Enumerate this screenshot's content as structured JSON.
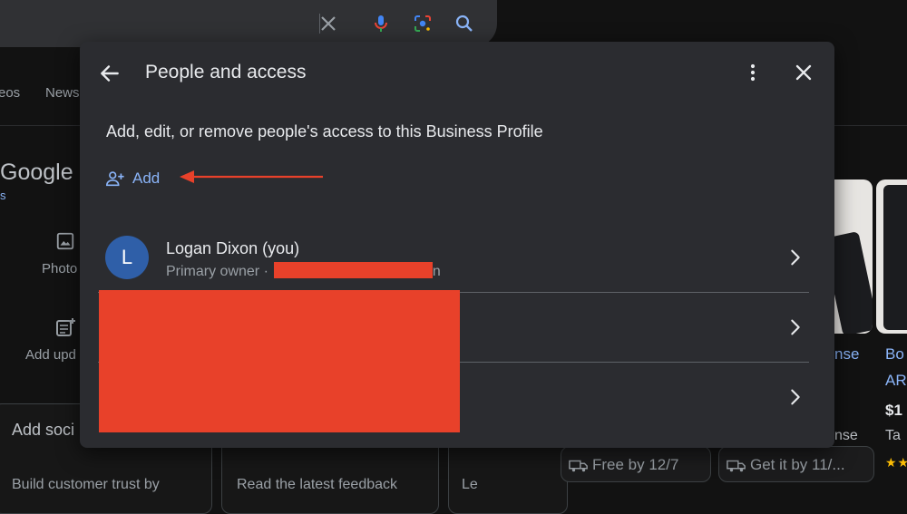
{
  "background": {
    "tabs": [
      "eos",
      "News"
    ],
    "brand_title": "Google",
    "brand_sub": "s",
    "actions": [
      "Photo",
      "Add upd"
    ],
    "cards": [
      {
        "title": "Add soci",
        "body": "Build customer trust by"
      },
      {
        "title": "",
        "body": "Read the latest feedback"
      },
      {
        "title": "",
        "body": "Le"
      }
    ],
    "products": {
      "link1": "nse",
      "link2a": "Bo",
      "link2b": "AR",
      "price": "$1",
      "price_note": "nse",
      "vendor": "Ta",
      "stars": "★★",
      "ship1": "Free by 12/7",
      "ship2": "Get it by 11/..."
    }
  },
  "dialog": {
    "title": "People and access",
    "description": "Add, edit, or remove people's access to this Business Profile",
    "add_label": "Add",
    "people": [
      {
        "initial": "L",
        "name": "Logan Dixon (you)",
        "role": "Primary owner ·",
        "role_tail": "n"
      }
    ]
  },
  "colors": {
    "accent": "#8ab4f8",
    "dialog_bg": "#2b2c30",
    "redaction": "#e8412a",
    "avatar": "#2f5fa8"
  },
  "icons": [
    "clear-icon",
    "mic-icon",
    "lens-icon",
    "search-icon",
    "back-arrow-icon",
    "more-vert-icon",
    "close-icon",
    "person-add-icon",
    "chevron-right-icon",
    "image-icon",
    "post-add-icon",
    "truck-icon"
  ]
}
